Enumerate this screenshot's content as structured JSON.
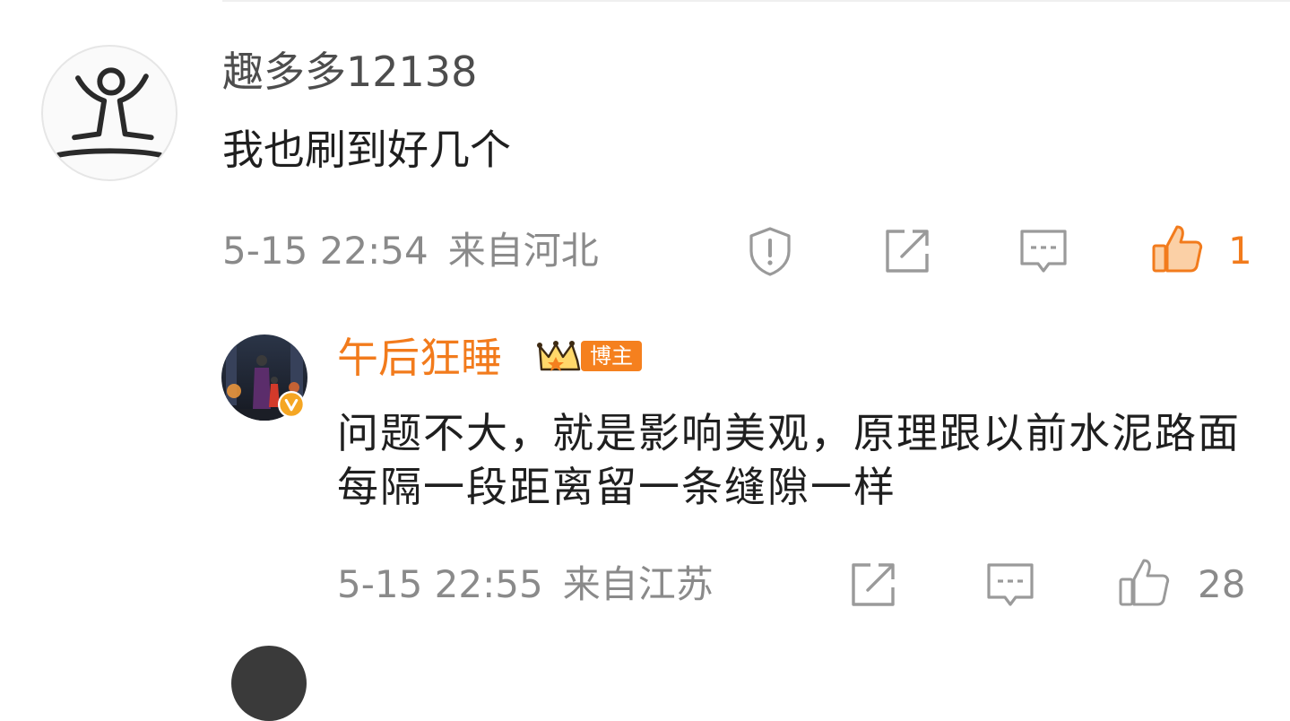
{
  "comment": {
    "username": "趣多多12138",
    "text": "我也刷到好几个",
    "time": "5-15 22:54",
    "location": "来自河北",
    "like_count": "1",
    "liked": true,
    "icons": {
      "report": "report-shield-icon",
      "share": "share-forward-icon",
      "reply": "reply-comment-icon",
      "like": "like-thumb-icon"
    }
  },
  "reply": {
    "username": "午后狂睡",
    "badge_label": "博主",
    "text": "问题不大，就是影响美观，原理跟以前水泥路面每隔一段距离留一条缝隙一样",
    "time": "5-15 22:55",
    "location": "来自江苏",
    "like_count": "28",
    "liked": false,
    "icons": {
      "share": "share-forward-icon",
      "reply": "reply-comment-icon",
      "like": "like-thumb-icon",
      "badge": "crown-level-badge-icon",
      "verified": "verified-v-icon"
    }
  },
  "colors": {
    "username_muted": "#4d4d4d",
    "meta_gray": "#8a8a8a",
    "icon_gray": "#9a9a9a",
    "author_orange": "#f27b1c",
    "like_active": "#f27b1c",
    "badge_orange": "#f5801e",
    "text_dark": "#1f1f1f"
  }
}
